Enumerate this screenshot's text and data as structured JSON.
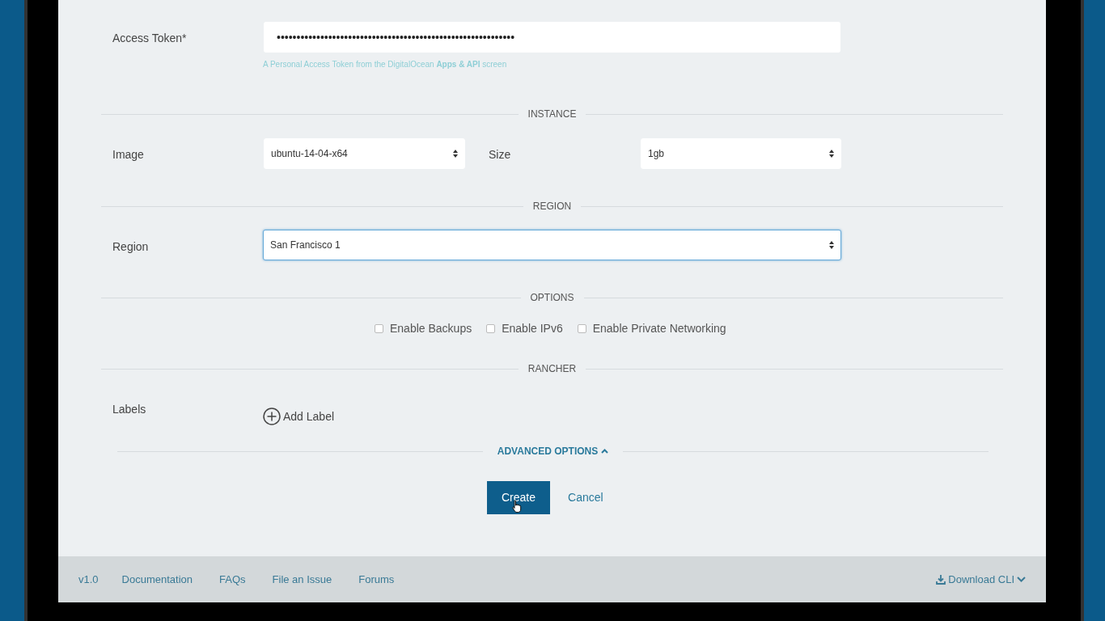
{
  "account_access": {
    "label": "Access Token*",
    "value": "••••••••••••••••••••••••••••••••••••••••••••••••••••••••••••",
    "help": "A Personal Access Token from the DigitalOcean **Apps & API** screen"
  },
  "instance": {
    "heading": "INSTANCE",
    "fields": [
      {
        "label": "Image",
        "value": "ubuntu-14-04-x64",
        "focused": false
      },
      {
        "label": "Size",
        "value": "1gb",
        "focused": false
      }
    ]
  },
  "region": {
    "heading": "REGION",
    "label": "Region",
    "value": "San Francisco 1",
    "focused": true
  },
  "options": {
    "heading": "OPTIONS",
    "checkboxes": [
      {
        "label": "Enable Backups",
        "checked": false
      },
      {
        "label": "Enable IPv6",
        "checked": false
      },
      {
        "label": "Enable Private Networking",
        "checked": false
      }
    ]
  },
  "rancher": {
    "heading": "RANCHER",
    "label": "Labels",
    "add_button": "Add Label"
  },
  "advanced_options": {
    "label": "ADVANCED OPTIONS",
    "expanded": true
  },
  "buttons": [
    {
      "label": "Create",
      "kind": "primary"
    },
    {
      "label": "Cancel",
      "kind": "link"
    }
  ],
  "footer": {
    "version": "v1.0",
    "links": [
      "Documentation",
      "FAQs",
      "File an Issue",
      "Forums"
    ],
    "download": "Download CLI"
  }
}
